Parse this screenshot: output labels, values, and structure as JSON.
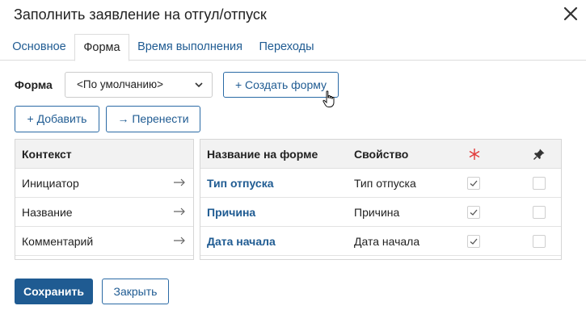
{
  "dialog": {
    "title": "Заполнить заявление на отгул/отпуск"
  },
  "tabs": [
    {
      "label": "Основное"
    },
    {
      "label": "Форма"
    },
    {
      "label": "Время выполнения"
    },
    {
      "label": "Переходы"
    }
  ],
  "active_tab": "Форма",
  "form_selector": {
    "label": "Форма",
    "value": "<По умолчанию>"
  },
  "buttons": {
    "create_form": "Создать форму",
    "add": "Добавить",
    "move": "Перенести",
    "save": "Сохранить",
    "close": "Закрыть"
  },
  "context_table": {
    "header": "Контекст",
    "rows": [
      "Инициатор",
      "Название",
      "Комментарий"
    ]
  },
  "form_table": {
    "headers": {
      "name": "Название на форме",
      "property": "Свойство"
    },
    "rows": [
      {
        "name": "Тип отпуска",
        "property": "Тип отпуска",
        "required": true,
        "readonly": false
      },
      {
        "name": "Причина",
        "property": "Причина",
        "required": true,
        "readonly": false
      },
      {
        "name": "Дата начала",
        "property": "Дата начала",
        "required": true,
        "readonly": false
      }
    ]
  },
  "icons": {
    "close": "close-icon",
    "chevron": "chevron-down-icon",
    "required": "asterisk-icon",
    "readonly": "pin-icon",
    "arrow": "arrow-right-icon",
    "check": "check-icon"
  },
  "colors": {
    "accent": "#1f5b92",
    "required_icon": "#e23b3b"
  }
}
